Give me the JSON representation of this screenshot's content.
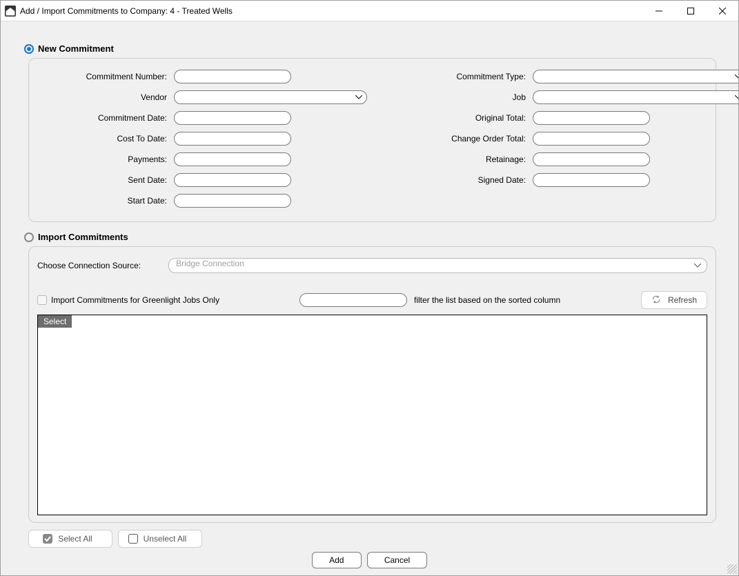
{
  "window": {
    "title": "Add / Import Commitments to Company: 4 - Treated Wells"
  },
  "modes": {
    "new_commitment_label": "New Commitment",
    "import_commitments_label": "Import Commitments",
    "selected": "new"
  },
  "new_form": {
    "left": {
      "commitment_number": {
        "label": "Commitment Number:",
        "value": ""
      },
      "vendor": {
        "label": "Vendor",
        "value": ""
      },
      "commitment_date": {
        "label": "Commitment Date:",
        "value": ""
      },
      "cost_to_date": {
        "label": "Cost To Date:",
        "value": ""
      },
      "payments": {
        "label": "Payments:",
        "value": ""
      },
      "sent_date": {
        "label": "Sent Date:",
        "value": ""
      },
      "start_date": {
        "label": "Start Date:",
        "value": ""
      }
    },
    "right": {
      "commitment_type": {
        "label": "Commitment Type:",
        "value": ""
      },
      "job": {
        "label": "Job",
        "value": ""
      },
      "original_total": {
        "label": "Original Total:",
        "value": ""
      },
      "change_order_total": {
        "label": "Change Order Total:",
        "value": ""
      },
      "retainage": {
        "label": "Retainage:",
        "value": ""
      },
      "signed_date": {
        "label": "Signed Date:",
        "value": ""
      }
    }
  },
  "import": {
    "connection_source_label": "Choose Connection Source:",
    "connection_source_value": "Bridge Connection",
    "greenlight_only_label": "Import Commitments for Greenlight Jobs Only",
    "filter_value": "",
    "filter_hint": "filter the list based on the sorted column",
    "refresh_label": "Refresh",
    "grid_header": "Select"
  },
  "actions": {
    "select_all": "Select All",
    "unselect_all": "Unselect All",
    "add": "Add",
    "cancel": "Cancel"
  }
}
